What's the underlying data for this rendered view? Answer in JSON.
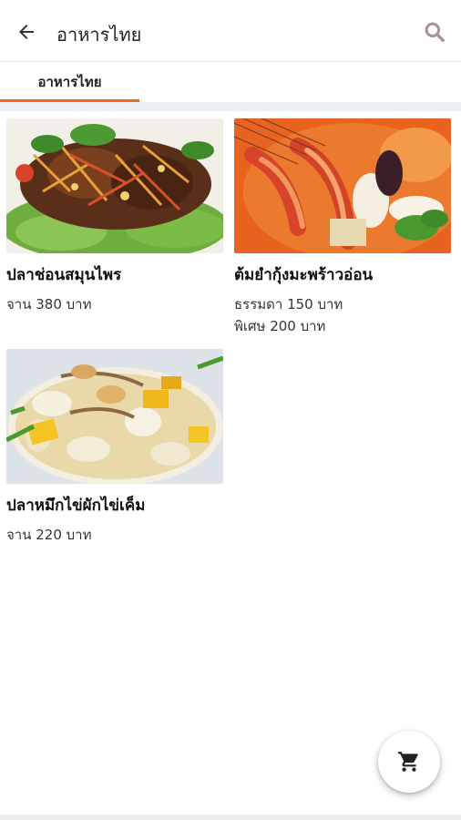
{
  "header": {
    "title": "อาหารไทย",
    "back_icon": "arrow-left-icon",
    "search_icon": "search-icon",
    "search_icon_color": "#a89490"
  },
  "tabs": [
    {
      "label": "อาหารไทย",
      "active": true
    }
  ],
  "accent_color": "#ef6c1f",
  "menu_items": [
    {
      "name": "ปลาช่อนสมุนไพร",
      "prices": [
        "จาน 380 บาท"
      ],
      "image": "crispy snakehead fish herb salad"
    },
    {
      "name": "ต้มยำกุ้งมะพร้าวอ่อน",
      "prices": [
        "ธรรมดา 150 บาท",
        "พิเศษ 200 บาท"
      ],
      "image": "tom yum shrimp soup"
    },
    {
      "name": "ปลาหมึกไข่ผักไข่เค็ม",
      "prices": [
        "จาน 220 บาท"
      ],
      "image": "stir-fried squid with salted egg"
    }
  ],
  "cart_icon": "cart-icon"
}
